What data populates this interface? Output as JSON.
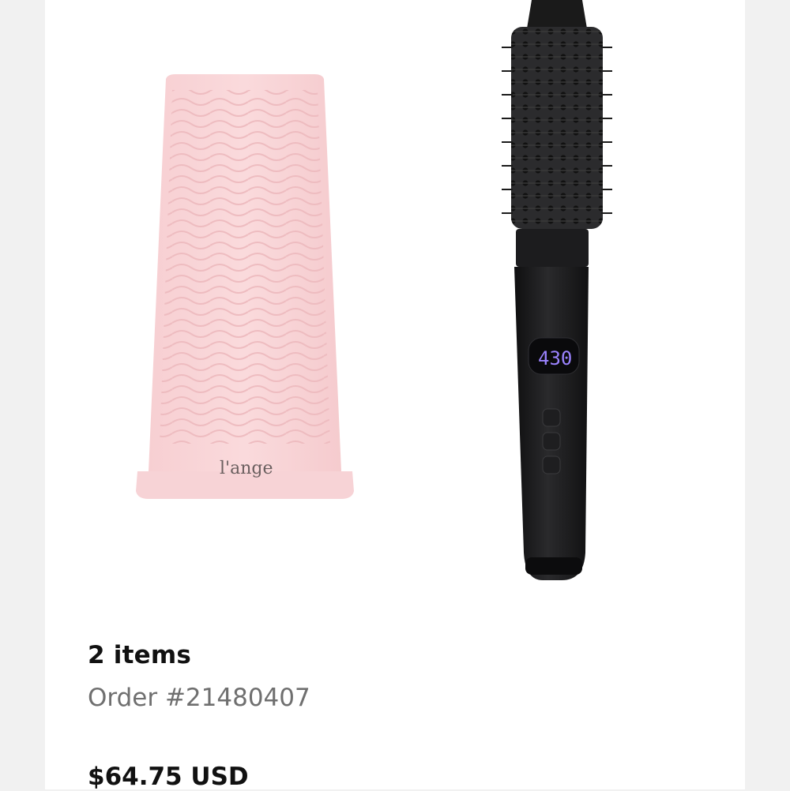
{
  "order": {
    "item_count_label": "2 items",
    "order_number_label": "Order #21480407",
    "total_label": "$64.75 USD"
  },
  "products": [
    {
      "name_icon": "heat-mat-image",
      "brand_wordmark": "l'ange",
      "color": "#f9d7d9"
    },
    {
      "name_icon": "heated-round-brush-image",
      "display_value": "430",
      "color": "#1d1d1f"
    }
  ]
}
